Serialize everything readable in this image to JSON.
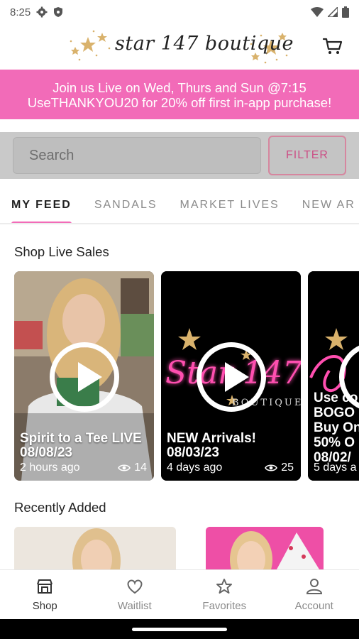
{
  "status_bar": {
    "time": "8:25",
    "icons": [
      "gear-icon",
      "shield-icon",
      "wifi-icon",
      "signal-icon",
      "battery-icon"
    ]
  },
  "header": {
    "brand": "star 147 boutique",
    "cart_icon": "cart-icon"
  },
  "promo": {
    "line1": "Join us Live on Wed, Thurs and Sun @7:15",
    "line2": "UseTHANKYOU20 for 20% off first in-app purchase!",
    "color": "#f26bb8"
  },
  "search": {
    "placeholder": "Search",
    "filter_label": "FILTER"
  },
  "tabs": [
    {
      "label": "MY FEED",
      "active": true
    },
    {
      "label": "SANDALS"
    },
    {
      "label": "MARKET LIVES"
    },
    {
      "label": "NEW AR"
    }
  ],
  "sections": {
    "live_title": "Shop Live Sales",
    "recent_title": "Recently Added"
  },
  "live_cards": [
    {
      "title": "Spirit to a Tee LIVE",
      "date": "08/08/23",
      "time": "2 hours ago",
      "views": "14"
    },
    {
      "title": "NEW Arrivals!",
      "date": "08/03/23",
      "time": "4 days ago",
      "views": "25",
      "logo": "Star 147",
      "logo_sub": "BOUTIQUE"
    },
    {
      "title_lines": [
        "Use co",
        "BOGO",
        "Buy On",
        "50% O"
      ],
      "date": "08/02/",
      "time": "5 days a"
    }
  ],
  "bottom_nav": [
    {
      "label": "Shop",
      "icon": "shop-icon",
      "active": true
    },
    {
      "label": "Waitlist",
      "icon": "heart-icon"
    },
    {
      "label": "Favorites",
      "icon": "star-icon"
    },
    {
      "label": "Account",
      "icon": "person-icon"
    }
  ],
  "colors": {
    "accent": "#f26bb8",
    "filter": "#cc4f86"
  }
}
